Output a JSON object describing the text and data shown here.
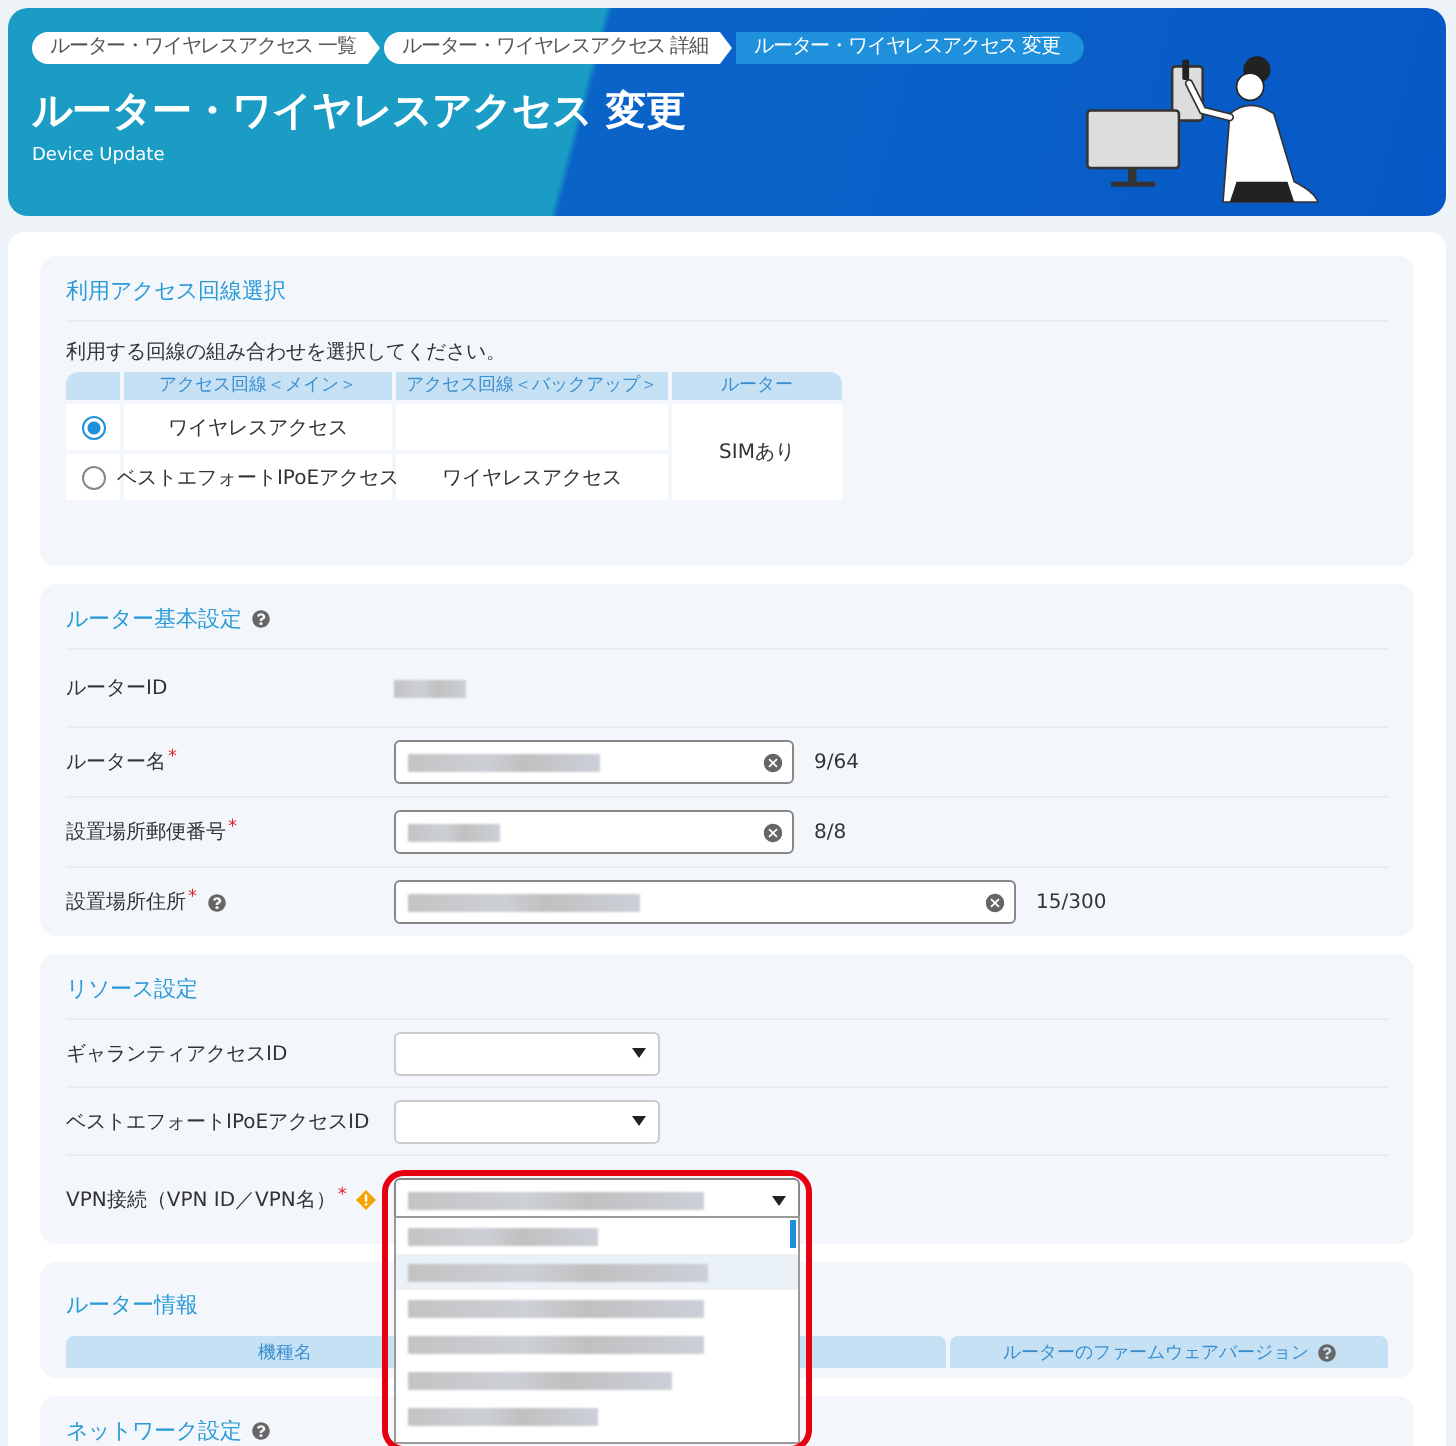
{
  "breadcrumbs": [
    {
      "label": "ルーター・ワイヤレスアクセス 一覧",
      "selected": false
    },
    {
      "label": "ルーター・ワイヤレスアクセス 詳細",
      "selected": false
    },
    {
      "label": "ルーター・ワイヤレスアクセス 変更",
      "selected": true
    }
  ],
  "header": {
    "title": "ルーター・ワイヤレスアクセス 変更",
    "subtitle": "Device Update"
  },
  "access_section": {
    "title": "利用アクセス回線選択",
    "instruction": "利用する回線の組み合わせを選択してください。",
    "columns": [
      "アクセス回線＜メイン＞",
      "アクセス回線＜バックアップ＞",
      "ルーター"
    ],
    "router": "SIMあり",
    "rows": [
      {
        "selected": true,
        "main": "ワイヤレスアクセス"
      },
      {
        "selected": false,
        "main": "ベストエフォートIPoEアクセス",
        "backup": "ワイヤレスアクセス"
      }
    ]
  },
  "basic_section": {
    "title": "ルーター基本設定",
    "help": true,
    "fields": [
      {
        "kind": "readonly",
        "label": "ルーターID",
        "help": false
      },
      {
        "kind": "text",
        "label": "ルーター名",
        "required_mark": "*",
        "help": false,
        "counter": "9/64"
      },
      {
        "kind": "text",
        "label": "設置場所郵便番号",
        "required_mark": "*",
        "help": false,
        "counter": "8/8"
      },
      {
        "kind": "wide",
        "label": "設置場所住所",
        "required_mark": "*",
        "help": true,
        "counter": "15/300"
      }
    ]
  },
  "resource_section": {
    "title": "リソース設定",
    "fields": [
      {
        "label": "ギャランティアクセスID",
        "warning": false,
        "expanded": false
      },
      {
        "label": "ベストエフォートIPoEアクセスID",
        "warning": false,
        "expanded": false
      },
      {
        "label": "VPN接続（VPN ID／VPN名）",
        "required_mark": "*",
        "warning": true,
        "expanded": true
      }
    ]
  },
  "vpn_options": [
    {
      "selected": false
    },
    {
      "selected": true
    },
    {
      "selected": false
    },
    {
      "selected": false
    },
    {
      "selected": false
    },
    {
      "selected": false
    }
  ],
  "router_info": {
    "title": "ルーター情報",
    "columns": [
      {
        "label": "機種名",
        "help": false
      },
      {
        "label": "ルーターのファームウェアバージョン",
        "help": true
      }
    ]
  },
  "network_section": {
    "title": "ネットワーク設定",
    "help": true
  }
}
